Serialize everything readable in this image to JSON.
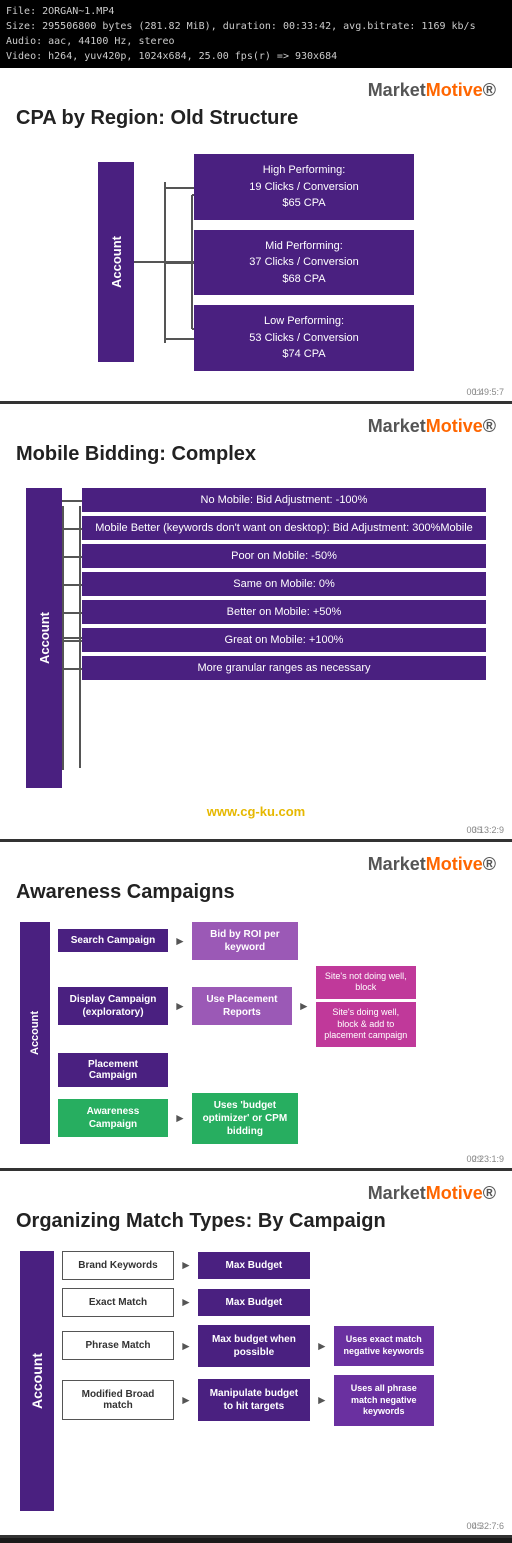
{
  "video_info": {
    "line1": "File: 2ORGAN~1.MP4",
    "line2": "Size: 295506800 bytes (281.82 MiB), duration: 00:33:42, avg.bitrate: 1169 kb/s",
    "line3": "Audio: aac, 44100 Hz, stereo",
    "line4": "Video: h264, yuv420p, 1024x684, 25.00 fps(r) => 930x684"
  },
  "logo": {
    "market": "Market",
    "motive": "Motive"
  },
  "slide1": {
    "title": "CPA by Region: Old Structure",
    "account_label": "Account",
    "boxes": [
      {
        "label": "High Performing:\n19 Clicks / Conversion\n$65 CPA"
      },
      {
        "label": "Mid Performing:\n37 Clicks / Conversion\n$68 CPA"
      },
      {
        "label": "Low Performing:\n53 Clicks / Conversion\n$74 CPA"
      }
    ],
    "timecode": "00:49:5:7",
    "slide_num": "11"
  },
  "slide2": {
    "title": "Mobile Bidding: Complex",
    "account_label": "Account",
    "items": [
      "No Mobile: Bid Adjustment: -100%",
      "Mobile Better (keywords don't want on desktop): Bid Adjustment: 300%Mobile",
      "Poor on Mobile: -50%",
      "Same on Mobile: 0%",
      "Better on Mobile: +50%",
      "Great on Mobile: +100%",
      "More granular ranges as necessary"
    ],
    "watermark": "www.cg-ku.com",
    "timecode": "00:13:2:9",
    "slide_num": "35"
  },
  "slide3": {
    "title": "Awareness Campaigns",
    "account_label": "Account",
    "rows": [
      {
        "left": "Search Campaign",
        "right_main": "Bid by ROI per keyword",
        "right_side": []
      },
      {
        "left": "Display Campaign\n(exploratory)",
        "right_main": "Use Placement Reports",
        "right_side": [
          "Site's not doing well, block",
          "Site's doing well, block & add to placement campaign"
        ]
      },
      {
        "left": "Placement Campaign",
        "right_main": null,
        "right_side": []
      },
      {
        "left": "Awareness Campaign",
        "left_color": "green",
        "right_main": "Uses 'budget optimizer' or CPM bidding",
        "right_side": []
      }
    ],
    "timecode": "00:23:1:9",
    "slide_num": "29"
  },
  "slide4": {
    "title": "Organizing Match Types: By Campaign",
    "account_label": "Account",
    "rows": [
      {
        "kw": "Brand Keywords",
        "budget": "Max Budget",
        "extra1": null,
        "extra2": null
      },
      {
        "kw": "Exact Match",
        "budget": "Max Budget",
        "extra1": null,
        "extra2": null
      },
      {
        "kw": "Phrase Match",
        "budget": "Max budget when possible",
        "extra1": "Uses exact match negative keywords",
        "extra2": null
      },
      {
        "kw": "Modified Broad match",
        "budget": "Manipulate budget to hit targets",
        "extra1": "Uses all phrase match negative keywords",
        "extra2": null
      }
    ],
    "timecode": "00:32:7:6",
    "slide_num": "45"
  }
}
